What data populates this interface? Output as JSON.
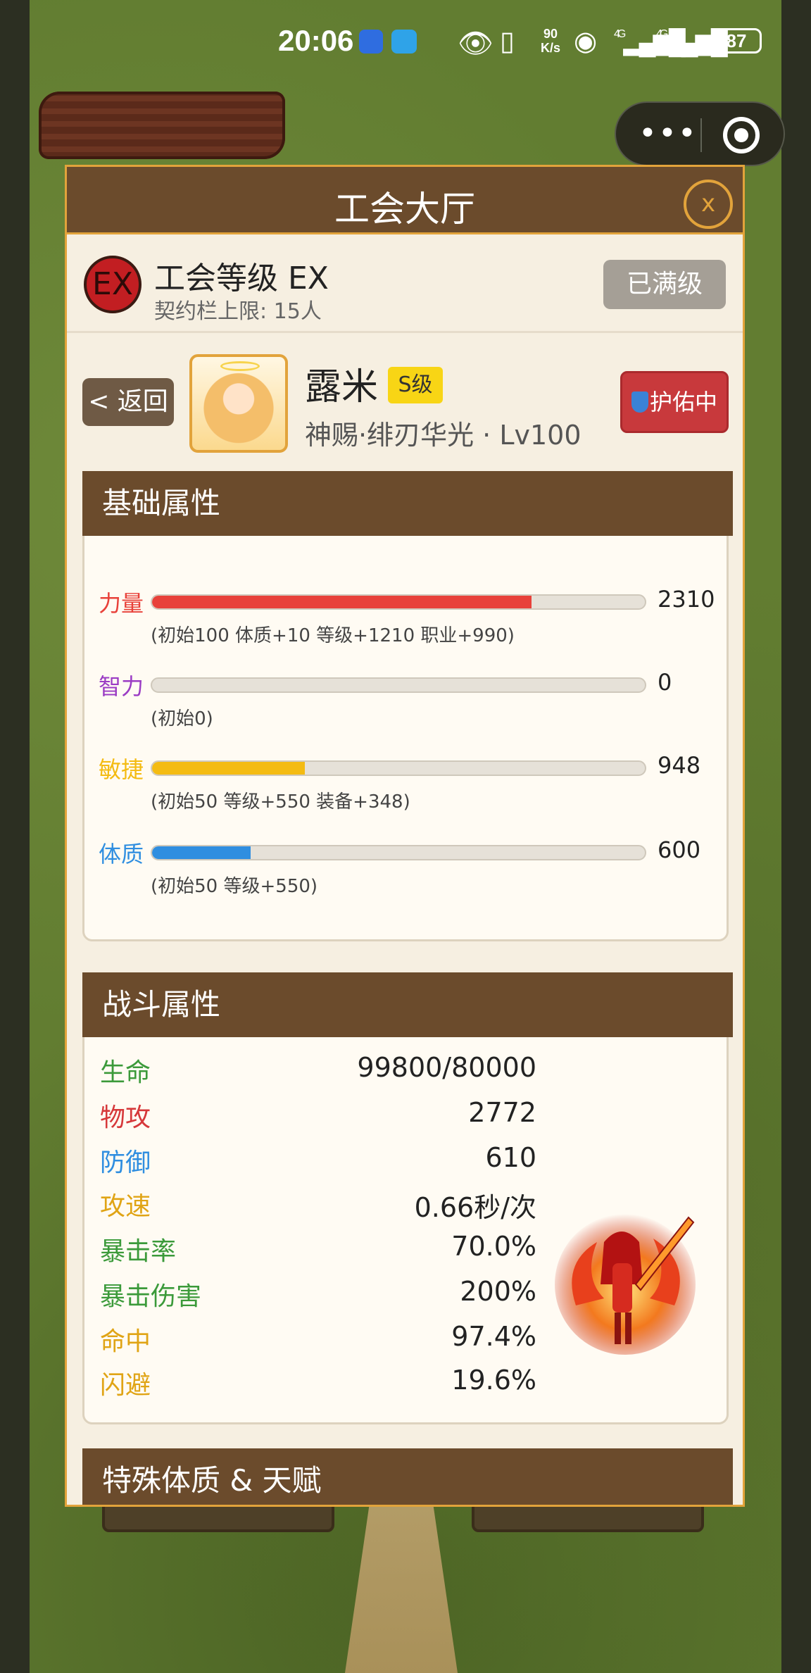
{
  "status_bar": {
    "time": "20:06",
    "speed_value": "90",
    "speed_unit": "K/s",
    "signal1": "4G",
    "signal2": "4G",
    "battery": "87",
    "icons": [
      "eye-icon",
      "vibrate-icon",
      "wifi-icon"
    ]
  },
  "capsule": {
    "more_label": "•••"
  },
  "panel": {
    "title": "工会大厅",
    "close_label": "x",
    "guild": {
      "badge": "EX",
      "level_label": "工会等级 EX",
      "limit_label": "契约栏上限: 15人",
      "maxed_button": "已满级"
    },
    "hero": {
      "back_button": "< 返回",
      "name": "露米",
      "rank": "S级",
      "subtitle": "神赐·绯刃华光 · Lv100",
      "protect_button": "护佑中"
    },
    "basic": {
      "title": "基础属性",
      "stats": [
        {
          "label": "力量",
          "value": "2310",
          "detail": "(初始100 体质+10 等级+1210 职业+990)",
          "fill": 0.77,
          "color": "#e8413a"
        },
        {
          "label": "智力",
          "value": "0",
          "detail": "(初始0)",
          "fill": 0.0,
          "color": "#9b3cc4"
        },
        {
          "label": "敏捷",
          "value": "948",
          "detail": "(初始50 等级+550 装备+348)",
          "fill": 0.31,
          "color": "#f4bb12"
        },
        {
          "label": "体质",
          "value": "600",
          "detail": "(初始50 等级+550)",
          "fill": 0.2,
          "color": "#2f8ee0"
        }
      ]
    },
    "combat": {
      "title": "战斗属性",
      "rows": [
        {
          "label": "生命",
          "value": "99800/80000",
          "color": "#3b9a3a"
        },
        {
          "label": "物攻",
          "value": "2772",
          "color": "#d6383a"
        },
        {
          "label": "防御",
          "value": "610",
          "color": "#2f8ee0"
        },
        {
          "label": "攻速",
          "value": "0.66秒/次",
          "color": "#e0a415"
        },
        {
          "label": "暴击率",
          "value": "70.0%",
          "color": "#3b9a3a"
        },
        {
          "label": "暴击伤害",
          "value": "200%",
          "color": "#3b9a3a"
        },
        {
          "label": "命中",
          "value": "97.4%",
          "color": "#e0a415"
        },
        {
          "label": "闪避",
          "value": "19.6%",
          "color": "#e0a415"
        }
      ]
    },
    "special": {
      "title": "特殊体质 & 天赋"
    }
  }
}
